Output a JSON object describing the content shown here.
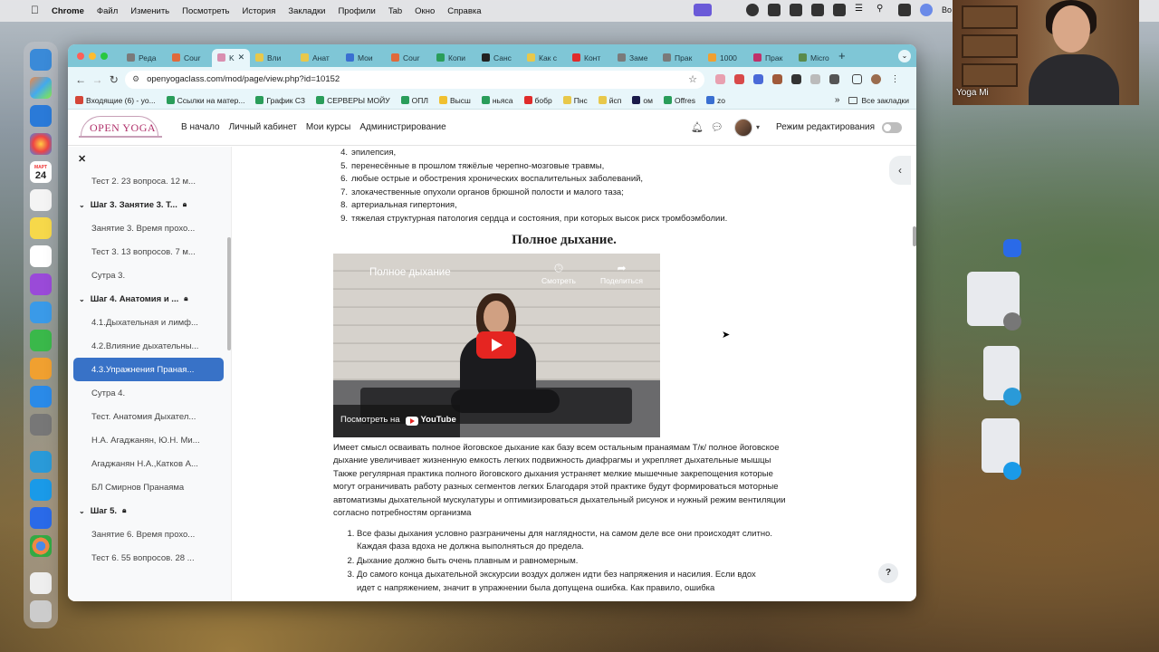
{
  "menubar": {
    "app": "Chrome",
    "items": [
      "Файл",
      "Изменить",
      "Посмотреть",
      "История",
      "Закладки",
      "Профили",
      "Tab",
      "Окно",
      "Справка"
    ],
    "right_text": "Во"
  },
  "webcam": {
    "name": "Yoga Mi"
  },
  "dock": {
    "calendar_day": "24",
    "calendar_month": "МАРТ"
  },
  "browser": {
    "tabs": [
      {
        "label": "Реда",
        "color": "#7a7a7a"
      },
      {
        "label": "Cour",
        "color": "#e06a3c"
      },
      {
        "label": "K",
        "color": "#d98fb0",
        "active": true
      },
      {
        "label": "Вли",
        "color": "#e8c84a"
      },
      {
        "label": "Анат",
        "color": "#e8c84a"
      },
      {
        "label": "Мои",
        "color": "#3a6fd1"
      },
      {
        "label": "Cour",
        "color": "#e06a3c"
      },
      {
        "label": "Копи",
        "color": "#2a9d5a"
      },
      {
        "label": "Санс",
        "color": "#222222"
      },
      {
        "label": "Как с",
        "color": "#e8c84a"
      },
      {
        "label": "Конт",
        "color": "#e02b2b"
      },
      {
        "label": "Заме",
        "color": "#7a7a7a"
      },
      {
        "label": "Прак",
        "color": "#7a7a7a"
      },
      {
        "label": "1000",
        "color": "#f0a030"
      },
      {
        "label": "Прак",
        "color": "#c0306a"
      },
      {
        "label": "Micro",
        "color": "#5a8a4a"
      }
    ],
    "url": "openyogaclass.com/mod/page/view.php?id=10152",
    "bookmarks": [
      {
        "label": "Входящие (6) - yo...",
        "color": "#d44638"
      },
      {
        "label": "Ссылки на матер...",
        "color": "#2a9d5a"
      },
      {
        "label": "График СЗ",
        "color": "#2a9d5a"
      },
      {
        "label": "СЕРВЕРЫ МОЙУ",
        "color": "#2a9d5a"
      },
      {
        "label": "ОПЛ",
        "color": "#2a9d5a"
      },
      {
        "label": "Высш",
        "color": "#f0c030"
      },
      {
        "label": "ньяса",
        "color": "#2a9d5a"
      },
      {
        "label": "бобр",
        "color": "#e02b2b"
      },
      {
        "label": "Пнс",
        "color": "#e8c84a"
      },
      {
        "label": "йсп",
        "color": "#e8c84a"
      },
      {
        "label": "ом",
        "color": "#1a1a4a"
      },
      {
        "label": "Offres",
        "color": "#2a9d5a"
      },
      {
        "label": "zo",
        "color": "#3a6fd1"
      }
    ],
    "bookmarks_more": "»",
    "all_bookmarks": "Все закладки"
  },
  "site": {
    "logo": "OPEN YOGA",
    "nav": [
      "В начало",
      "Личный кабинет",
      "Мои курсы",
      "Администрирование"
    ],
    "edit_mode_label": "Режим редактирования"
  },
  "sidebar": {
    "items": [
      {
        "label": "Тест 2. 23 вопроса. 12 м...",
        "type": "item"
      },
      {
        "label": "Шаг 3. Занятие 3. Т...",
        "type": "section"
      },
      {
        "label": "Занятие 3. Время прохо...",
        "type": "item"
      },
      {
        "label": "Тест 3. 13 вопросов. 7 м...",
        "type": "item"
      },
      {
        "label": "Сутра 3.",
        "type": "item"
      },
      {
        "label": "Шаг 4. Анатомия и ...",
        "type": "section"
      },
      {
        "label": "4.1.Дыхательная и лимф...",
        "type": "item"
      },
      {
        "label": "4.2.Влияние дыхательны...",
        "type": "item"
      },
      {
        "label": "4.3.Упражнения Праная...",
        "type": "active"
      },
      {
        "label": "Сутра 4.",
        "type": "item"
      },
      {
        "label": "Тест. Анатомия Дыхател...",
        "type": "item"
      },
      {
        "label": "Н.А. Агаджанян, Ю.Н. Ми...",
        "type": "item"
      },
      {
        "label": "Агаджанян Н.А.,Катков А...",
        "type": "item"
      },
      {
        "label": "БЛ Смирнов Пранаяма",
        "type": "item"
      },
      {
        "label": "Шаг 5.",
        "type": "section"
      },
      {
        "label": "Занятие 6. Время прохо...",
        "type": "item"
      },
      {
        "label": "Тест 6. 55 вопросов. 28 ...",
        "type": "item"
      }
    ]
  },
  "article": {
    "contra_list": [
      {
        "num": "4.",
        "text": "эпилепсия,"
      },
      {
        "num": "5.",
        "text": "перенесённые в прошлом тяжёлые черепно-мозговые травмы,"
      },
      {
        "num": "6.",
        "text": "любые острые и обострения хронических воспалительных заболеваний,"
      },
      {
        "num": "7.",
        "text": " злокачественные опухоли органов брюшной полости и малого таза;"
      },
      {
        "num": "8.",
        "text": "артериальная гипертония,"
      },
      {
        "num": "9.",
        "text": "тяжелая структурная патология сердца и состояния, при которых высок риск тромбоэмболии."
      }
    ],
    "heading": "Полное дыхание.",
    "video": {
      "title": "Полное дыхание",
      "watch_later": "Смотреть",
      "share": "Поделиться",
      "watch_on": "Посмотреть на",
      "youtube": "YouTube"
    },
    "paragraph": "Имеет смысл осваивать полное йоговское дыхание как базу всем остальным пранаямам Т/к/ полное йоговское дыхание увеличивает жизненную емкость легких подвижность диафрагмы и укрепляет дыхательные мышцы Также регулярная практика полного йоговского дыхания устраняет мелкие мышечные закрепощения которые могут ограничивать работу разных сегментов легких Благодаря этой практике будут формироваться моторные автоматизмы дыхательной мускулатуры и оптимизироваться дыхательный рисунок и нужный режим вентиляции  согласно потребностям организма",
    "rules": [
      {
        "num": "1.",
        "text": "Все фазы дыхания условно разграничены для наглядности, на самом деле все они происходят слитно. Каждая фаза вдоха не должна выполняться до предела."
      },
      {
        "num": "2.",
        "text": "Дыхание должно быть очень плавным и равномерным."
      },
      {
        "num": "3.",
        "text": "До самого конца дыхательной экскурсии воздух должен идти без напряжения и насилия. Если вдох идет с напряжением, значит в упражнении была допущена ошибка. Как правило, ошибка"
      }
    ]
  },
  "help": "?"
}
